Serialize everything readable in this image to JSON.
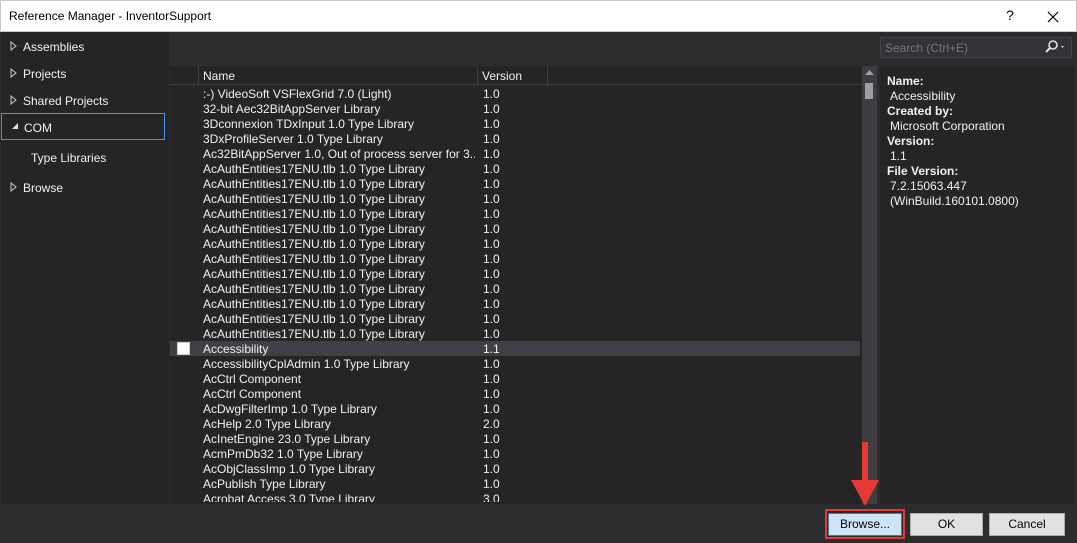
{
  "window": {
    "title": "Reference Manager - InventorSupport",
    "help": "?"
  },
  "nav": {
    "items": [
      {
        "label": "Assemblies"
      },
      {
        "label": "Projects"
      },
      {
        "label": "Shared Projects"
      },
      {
        "label": "COM"
      },
      {
        "label": "Type Libraries"
      },
      {
        "label": "Browse"
      }
    ]
  },
  "search": {
    "placeholder": "Search (Ctrl+E)"
  },
  "list": {
    "columns": [
      "Name",
      "Version"
    ],
    "rows": [
      {
        "name": ":-) VideoSoft VSFlexGrid 7.0 (Light)",
        "version": "1.0"
      },
      {
        "name": "32-bit Aec32BitAppServer Library",
        "version": "1.0"
      },
      {
        "name": "3Dconnexion TDxInput 1.0 Type Library",
        "version": "1.0"
      },
      {
        "name": "3DxProfileServer 1.0 Type Library",
        "version": "1.0"
      },
      {
        "name": "Ac32BitAppServer 1.0, Out of process server for 3...",
        "version": "1.0"
      },
      {
        "name": "AcAuthEntities17ENU.tlb 1.0 Type Library",
        "version": "1.0"
      },
      {
        "name": "AcAuthEntities17ENU.tlb 1.0 Type Library",
        "version": "1.0"
      },
      {
        "name": "AcAuthEntities17ENU.tlb 1.0 Type Library",
        "version": "1.0"
      },
      {
        "name": "AcAuthEntities17ENU.tlb 1.0 Type Library",
        "version": "1.0"
      },
      {
        "name": "AcAuthEntities17ENU.tlb 1.0 Type Library",
        "version": "1.0"
      },
      {
        "name": "AcAuthEntities17ENU.tlb 1.0 Type Library",
        "version": "1.0"
      },
      {
        "name": "AcAuthEntities17ENU.tlb 1.0 Type Library",
        "version": "1.0"
      },
      {
        "name": "AcAuthEntities17ENU.tlb 1.0 Type Library",
        "version": "1.0"
      },
      {
        "name": "AcAuthEntities17ENU.tlb 1.0 Type Library",
        "version": "1.0"
      },
      {
        "name": "AcAuthEntities17ENU.tlb 1.0 Type Library",
        "version": "1.0"
      },
      {
        "name": "AcAuthEntities17ENU.tlb 1.0 Type Library",
        "version": "1.0"
      },
      {
        "name": "AcAuthEntities17ENU.tlb 1.0 Type Library",
        "version": "1.0"
      },
      {
        "name": "Accessibility",
        "version": "1.1"
      },
      {
        "name": "AccessibilityCplAdmin 1.0 Type Library",
        "version": "1.0"
      },
      {
        "name": "AcCtrl Component",
        "version": "1.0"
      },
      {
        "name": "AcCtrl Component",
        "version": "1.0"
      },
      {
        "name": "AcDwgFilterImp 1.0 Type Library",
        "version": "1.0"
      },
      {
        "name": "AcHelp 2.0 Type Library",
        "version": "2.0"
      },
      {
        "name": "AcInetEngine 23.0 Type Library",
        "version": "1.0"
      },
      {
        "name": "AcmPmDb32 1.0 Type Library",
        "version": "1.0"
      },
      {
        "name": "AcObjClassImp 1.0 Type Library",
        "version": "1.0"
      },
      {
        "name": "AcPublish Type Library",
        "version": "1.0"
      },
      {
        "name": "Acrobat Access 3.0 Type Library",
        "version": "3.0"
      }
    ]
  },
  "details": {
    "name_label": "Name:",
    "name_value": "Accessibility",
    "created_label": "Created by:",
    "created_value": "Microsoft Corporation",
    "version_label": "Version:",
    "version_value": "1.1",
    "file_version_label": "File Version:",
    "file_version_value": "7.2.15063.447",
    "file_version_build": "(WinBuild.160101.0800)"
  },
  "buttons": {
    "browse": "Browse...",
    "ok": "OK",
    "cancel": "Cancel"
  },
  "colors": {
    "accent": "#3399ff",
    "highlight": "#e53935",
    "background": "#2d2d30"
  }
}
